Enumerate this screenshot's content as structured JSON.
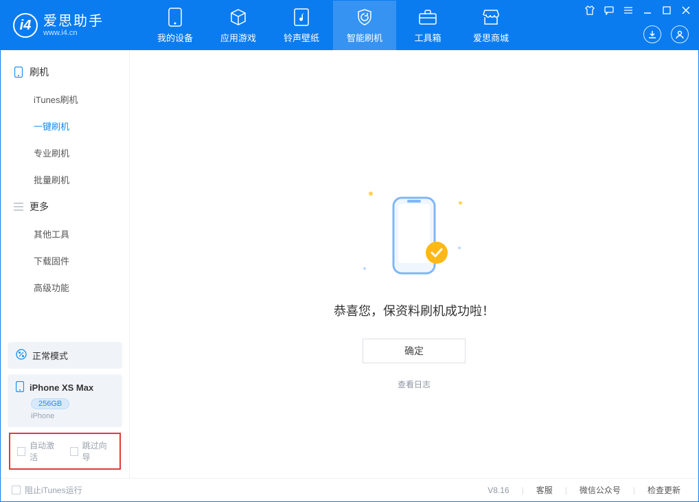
{
  "app": {
    "name": "爱思助手",
    "url": "www.i4.cn"
  },
  "nav": {
    "tabs": [
      {
        "label": "我的设备",
        "icon": "device"
      },
      {
        "label": "应用游戏",
        "icon": "cube"
      },
      {
        "label": "铃声壁纸",
        "icon": "music"
      },
      {
        "label": "智能刷机",
        "icon": "shield"
      },
      {
        "label": "工具箱",
        "icon": "toolbox"
      },
      {
        "label": "爱思商城",
        "icon": "store"
      }
    ],
    "activeIndex": 3
  },
  "sidebar": {
    "group1": {
      "title": "刷机"
    },
    "items1": [
      {
        "label": "iTunes刷机"
      },
      {
        "label": "一键刷机"
      },
      {
        "label": "专业刷机"
      },
      {
        "label": "批量刷机"
      }
    ],
    "activeItem1": 1,
    "group2": {
      "title": "更多"
    },
    "items2": [
      {
        "label": "其他工具"
      },
      {
        "label": "下载固件"
      },
      {
        "label": "高级功能"
      }
    ],
    "mode": {
      "label": "正常模式"
    },
    "device": {
      "name": "iPhone XS Max",
      "capacity": "256GB",
      "sub": "iPhone"
    },
    "checks": {
      "autoActivate": "自动激活",
      "skipGuide": "跳过向导"
    }
  },
  "main": {
    "successText": "恭喜您，保资料刷机成功啦！",
    "okButton": "确定",
    "viewLog": "查看日志"
  },
  "statusbar": {
    "blockItunes": "阻止iTunes运行",
    "version": "V8.16",
    "links": {
      "support": "客服",
      "wechat": "微信公众号",
      "update": "检查更新"
    }
  }
}
